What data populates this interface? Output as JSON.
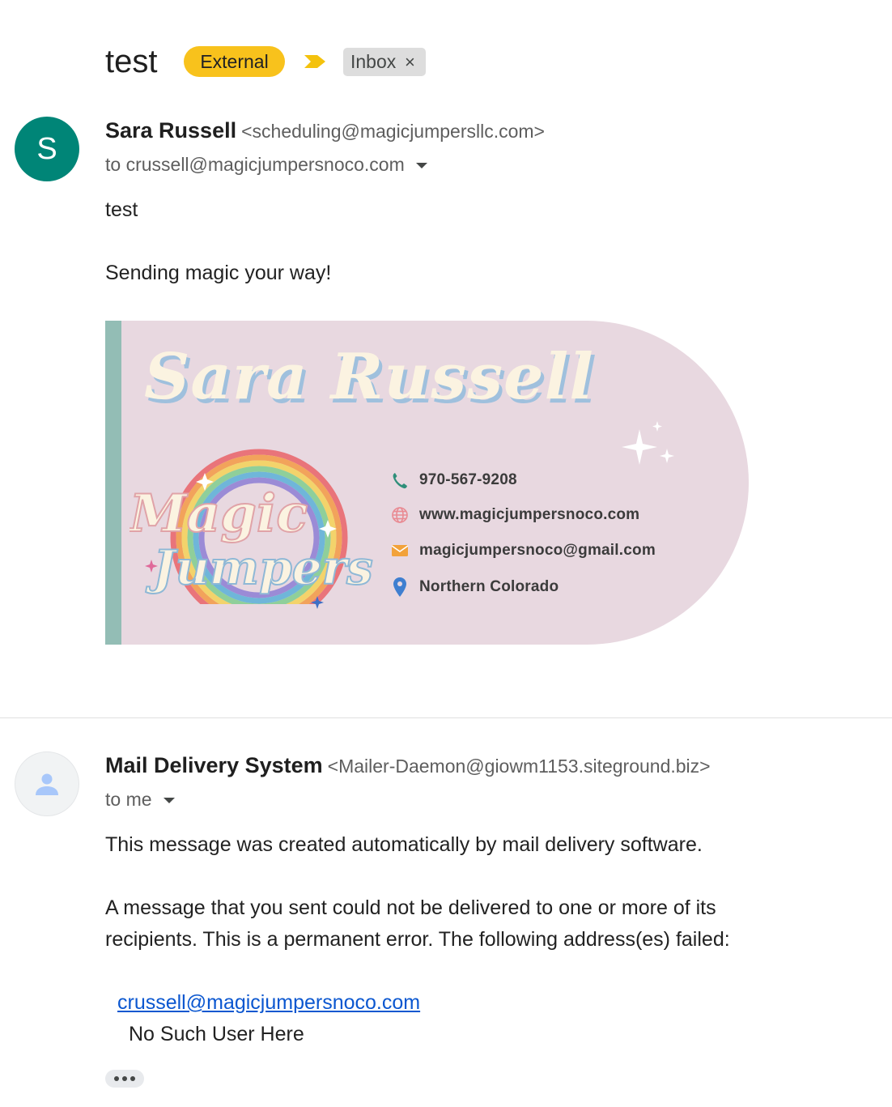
{
  "thread": {
    "subject": "test",
    "labels": {
      "external": "External",
      "inbox": "Inbox",
      "remove": "×"
    }
  },
  "message1": {
    "avatar_letter": "S",
    "sender_name": "Sara Russell",
    "sender_email": "<scheduling@magicjumpersllc.com>",
    "to_line": "to crussell@magicjumpersnoco.com",
    "body_line1": "test",
    "body_line2": "Sending magic your way!",
    "signature": {
      "name": "Sara Russell",
      "logo_text_1": "Magic",
      "logo_text_2": "Jumpers",
      "phone": "970-567-9208",
      "website": "www.magicjumpersnoco.com",
      "email": "magicjumpersnoco@gmail.com",
      "location": "Northern Colorado"
    }
  },
  "message2": {
    "avatar_icon": "person-icon",
    "sender_name": "Mail Delivery System",
    "sender_email": "<Mailer-Daemon@giowm1153.siteground.biz>",
    "to_line": "to me",
    "para1": "This message was created automatically by mail delivery software.",
    "para2_line1": "A message that you sent could not be delivered to one or more of its",
    "para2_line2": "recipients. This is a permanent error. The following address(es) failed:",
    "failed_address": "crussell@magicjumpersnoco.com",
    "failure_reason": "No Such User Here"
  },
  "colors": {
    "external_label": "#f8c21c",
    "avatar_s": "#008577",
    "link": "#0b57d0",
    "signature_bg": "#e8d8e0",
    "signature_bar": "#93bdb5"
  }
}
